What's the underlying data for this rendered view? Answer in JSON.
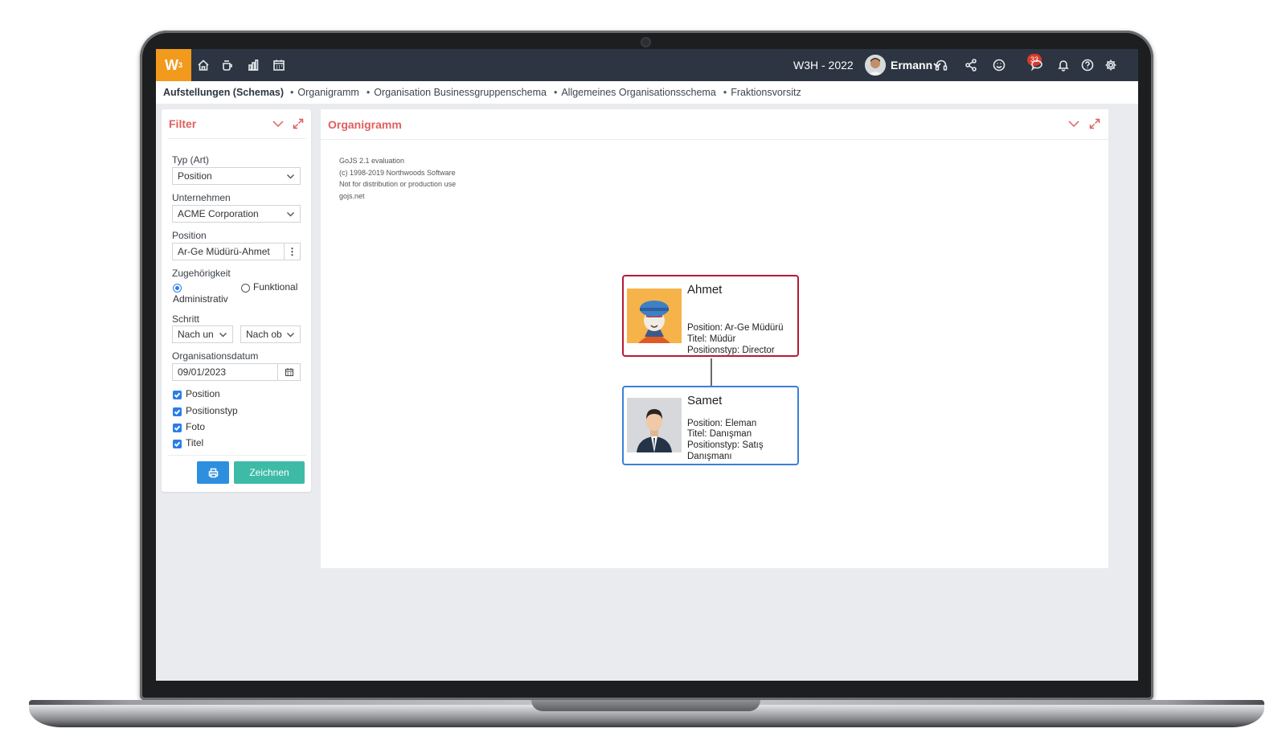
{
  "topbar": {
    "logo": "W",
    "logo_sup": "3",
    "icons": [
      "home-icon",
      "coffee-icon",
      "bar-chart-icon",
      "calendar-icon"
    ],
    "app_title": "W3H - 2022",
    "user_name": "Ermann",
    "right_icons": [
      "headset-icon",
      "share-icon",
      "smiley-icon",
      "chat-icon",
      "bell-icon",
      "help-icon",
      "gear-icon"
    ],
    "notification_count": "33"
  },
  "breadcrumb": {
    "root": "Aufstellungen (Schemas)",
    "items": [
      "Organigramm",
      "Organisation Businessgruppenschema",
      "Allgemeines Organisationsschema",
      "Fraktionsvorsitz"
    ]
  },
  "filter": {
    "title": "Filter",
    "type_label": "Typ (Art)",
    "type_value": "Position",
    "company_label": "Unternehmen",
    "company_value": "ACME Corporation",
    "position_label": "Position",
    "position_value": "Ar-Ge Müdürü-Ahmet",
    "affiliation_label": "Zugehörigkeit",
    "affiliation_options": [
      "Administrativ",
      "Funktional"
    ],
    "affiliation_selected": "Administrativ",
    "step_label": "Schritt",
    "step_down": "Nach un",
    "step_up": "Nach ob",
    "date_label": "Organisationsdatum",
    "date_value": "09/01/2023",
    "checkboxes": [
      "Position",
      "Positionstyp",
      "Foto",
      "Titel"
    ],
    "draw_label": "Zeichnen"
  },
  "org": {
    "title": "Organigramm",
    "watermark": [
      "GoJS 2.1 evaluation",
      "(c) 1998-2019 Northwoods Software",
      "Not for distribution or production use",
      "gojs.net"
    ],
    "nodes": [
      {
        "name": "Ahmet",
        "position": "Position: Ar-Ge Müdürü",
        "title": "Titel: Müdür",
        "type": "Positionstyp: Director"
      },
      {
        "name": "Samet",
        "position": "Position: Eleman",
        "title": "Titel: Danışman",
        "type": "Positionstyp: Satış",
        "type_cont": "Danışmanı"
      }
    ]
  },
  "colors": {
    "topbar": "#2c3541",
    "logo": "#f29a1c",
    "panel_title": "#e05f5f",
    "boss_border": "#b61a35",
    "staff_border": "#3b7fd6",
    "primary_button": "#2e8fde",
    "draw_button": "#3dbba6"
  }
}
